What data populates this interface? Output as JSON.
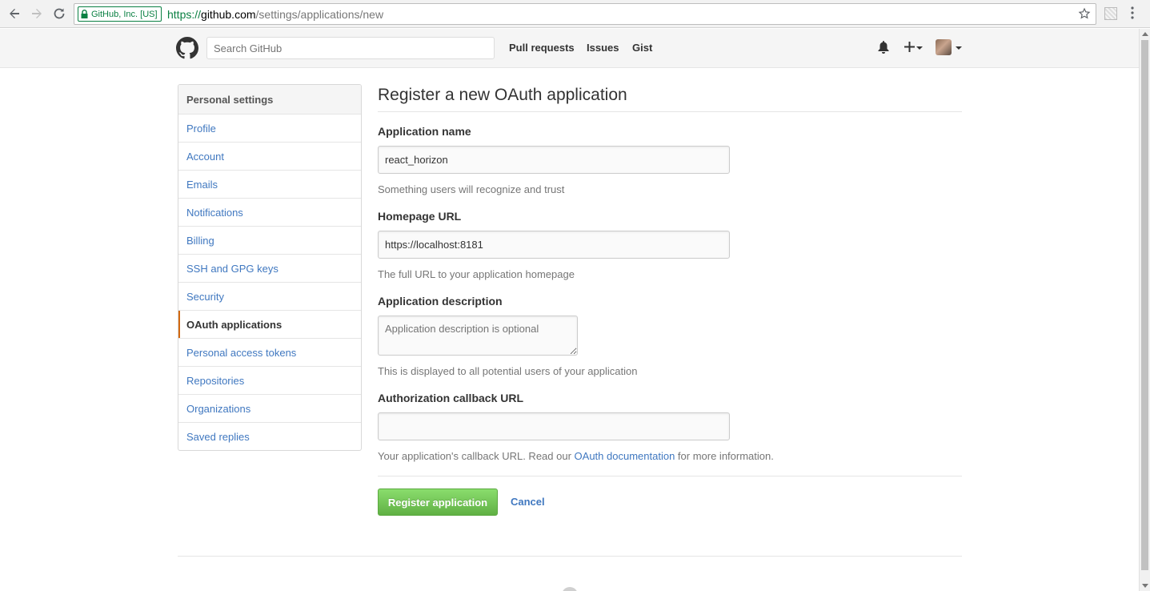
{
  "browser": {
    "security_label": "GitHub, Inc. [US]",
    "url_protocol": "https://",
    "url_host": "github.com",
    "url_path": "/settings/applications/new"
  },
  "header": {
    "search_placeholder": "Search GitHub",
    "nav": [
      "Pull requests",
      "Issues",
      "Gist"
    ]
  },
  "sidebar": {
    "title": "Personal settings",
    "items": [
      {
        "label": "Profile"
      },
      {
        "label": "Account"
      },
      {
        "label": "Emails"
      },
      {
        "label": "Notifications"
      },
      {
        "label": "Billing"
      },
      {
        "label": "SSH and GPG keys"
      },
      {
        "label": "Security"
      },
      {
        "label": "OAuth applications",
        "selected": true
      },
      {
        "label": "Personal access tokens"
      },
      {
        "label": "Repositories"
      },
      {
        "label": "Organizations"
      },
      {
        "label": "Saved replies"
      }
    ]
  },
  "form": {
    "title": "Register a new OAuth application",
    "app_name_label": "Application name",
    "app_name_value": "react_horizon",
    "app_name_note": "Something users will recognize and trust",
    "homepage_label": "Homepage URL",
    "homepage_value": "https://localhost:8181",
    "homepage_note": "The full URL to your application homepage",
    "description_label": "Application description",
    "description_placeholder": "Application description is optional",
    "description_note": "This is displayed to all potential users of your application",
    "callback_label": "Authorization callback URL",
    "callback_value": "",
    "callback_note_before": "Your application's callback URL. Read our",
    "callback_note_link": "OAuth documentation",
    "callback_note_after": "for more information.",
    "register_label": "Register application",
    "cancel_label": "Cancel"
  },
  "colors": {
    "link": "#4078c0",
    "selected_accent": "#d26911",
    "button_green": "#60b044",
    "secure_green": "#0b8043"
  }
}
